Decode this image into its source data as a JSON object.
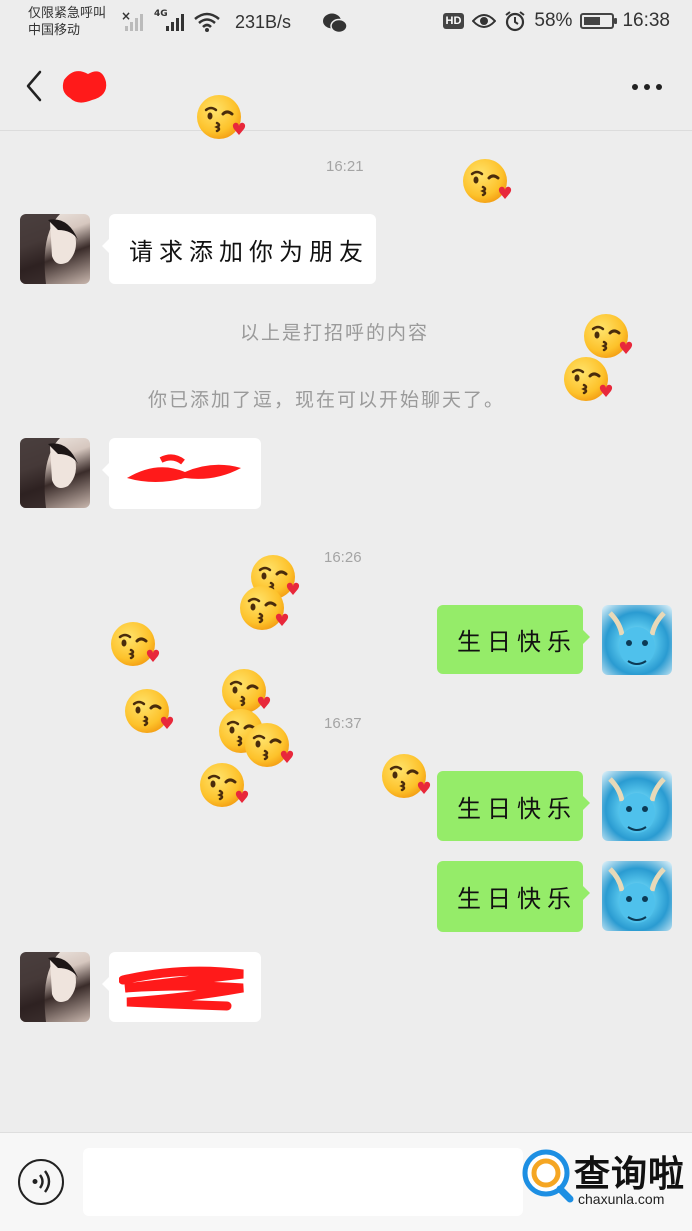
{
  "status_bar": {
    "carrier_line1": "仅限紧急呼叫",
    "carrier_line2": "中国移动",
    "network": "4G",
    "speed": "231B/s",
    "hd": "HD",
    "battery": "58%",
    "battery_level": 0.58,
    "time": "16:38"
  },
  "header": {
    "back_icon": "chevron-left-icon",
    "more_icon": "more-dots-icon"
  },
  "messages": {
    "time_1621": "16:21",
    "friend_request": "请求添加你为朋友",
    "sys_greeting": "以上是打招呼的内容",
    "sys_added": "你已添加了逗，现在可以开始聊天了。",
    "time_1626": "16:26",
    "out_1": "生日快乐",
    "time_1637": "16:37",
    "out_2": "生日快乐",
    "out_3": "生日快乐"
  },
  "bottom_bar": {
    "voice_icon": "voice-icon",
    "watermark_text": "查询啦",
    "watermark_url": "chaxunla.com"
  },
  "colors": {
    "background": "#ededed",
    "outgoing_bubble": "#95ec69",
    "incoming_bubble": "#ffffff",
    "redaction": "#ff1a1a"
  }
}
